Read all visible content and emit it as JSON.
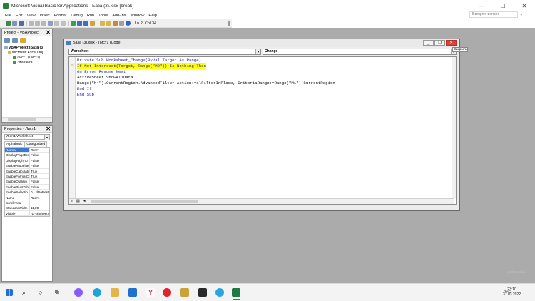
{
  "window": {
    "title": "Microsoft Visual Basic for Applications - База (3).xlsx [break]",
    "minimize": "—",
    "maximize": "☐",
    "close": "✕"
  },
  "menu": {
    "items": [
      "File",
      "Edit",
      "View",
      "Insert",
      "Format",
      "Debug",
      "Run",
      "Tools",
      "Add-Ins",
      "Window",
      "Help"
    ],
    "help_placeholder": "Введите вопрос"
  },
  "toolbar": {
    "cursor_position": "Ln 2, Col 34"
  },
  "project_panel": {
    "title": "Project - VBAProject",
    "tree": [
      "VBAProject (База (3",
      "Microsoft Excel Obj",
      "Лист1 (Лист1)",
      "ЭтаКнига"
    ]
  },
  "properties_panel": {
    "title": "Properties - Лист1",
    "object_select": "Лист1 Worksheet",
    "tabs": [
      "Alphabetic",
      "Categorized"
    ],
    "rows": [
      {
        "name": "(Name)",
        "value": "Лист1"
      },
      {
        "name": "DisplayPageBre",
        "value": "False"
      },
      {
        "name": "DisplayRightTo",
        "value": "False"
      },
      {
        "name": "EnableAutoFilte",
        "value": "False"
      },
      {
        "name": "EnableCalculati",
        "value": "True"
      },
      {
        "name": "EnableFormatC",
        "value": "True"
      },
      {
        "name": "EnableOutlinin",
        "value": "False"
      },
      {
        "name": "EnablePivotTab",
        "value": "False"
      },
      {
        "name": "EnableSelectio",
        "value": "0 - xlNoRestri"
      },
      {
        "name": "Name",
        "value": "Лист1"
      },
      {
        "name": "ScrollArea",
        "value": ""
      },
      {
        "name": "StandardWidth",
        "value": "11,89"
      },
      {
        "name": "Visible",
        "value": "-1 - xlSheetVi"
      }
    ]
  },
  "code_window": {
    "title": "База (3).xlsx - Лист1 (Code)",
    "object_combo": "Worksheet",
    "procedure_combo": "Change",
    "close_tooltip": "Закрыть",
    "lines": [
      "Private Sub Worksheet_Change(ByVal Target As Range)",
      "If Not Intersect(Target, Range(\"M2\")) Is Nothing Then",
      "On Error Resume Next",
      "ActiveSheet.ShowAllData",
      "Range(\"M4\").CurrentRegion.AdvancedFilter Action:=xlFilterInPlace, CriteriaRange:=Range(\"M1\").CurrentRegion",
      "End If",
      "End Sub"
    ]
  },
  "taskbar": {
    "lang": "РУС",
    "time": "23:10",
    "date": "31.03.2022"
  },
  "watermark": "gcdwab1a"
}
